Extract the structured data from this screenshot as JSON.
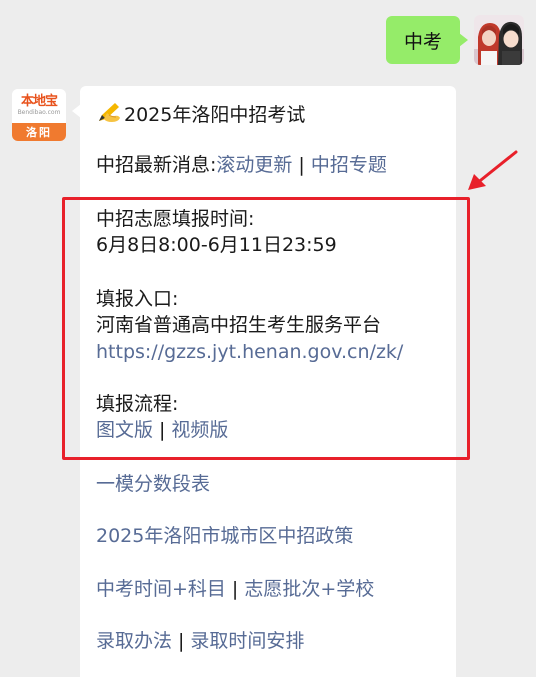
{
  "chat": {
    "sent_message": "中考",
    "bot_logo": {
      "brand_text": "本地宝",
      "sub_text": "Bendibao.com",
      "city_text": "洛阳"
    },
    "reply": {
      "title": "2025年洛阳中招考试",
      "news_label": "中招最新消息:",
      "news_links": [
        "滚动更新",
        "中招专题"
      ],
      "apply_time_label": "中招志愿填报时间:",
      "apply_time_value": "6月8日8:00-6月11日23:59",
      "entry_label": "填报入口:",
      "entry_name": "河南省普通高中招生考生服务平台",
      "entry_url": "https://gzzs.jyt.henan.gov.cn/zk/",
      "process_label": "填报流程:",
      "process_links": [
        "图文版",
        "视频版"
      ],
      "score_link": "一模分数段表",
      "policy_link": "2025年洛阳市城市区中招政策",
      "exam_links": [
        "中考时间+科目",
        "志愿批次+学校"
      ],
      "admission_links": [
        "录取办法",
        "录取时间安排"
      ]
    }
  },
  "colors": {
    "background": "#ededed",
    "sent_bubble": "#95ec69",
    "received_bubble": "#ffffff",
    "link": "#576b95",
    "annotation_red": "#e8202a",
    "brand_orange": "#f07a2f"
  },
  "icons": [
    "writing-hand-icon",
    "annotation-arrow-icon"
  ]
}
